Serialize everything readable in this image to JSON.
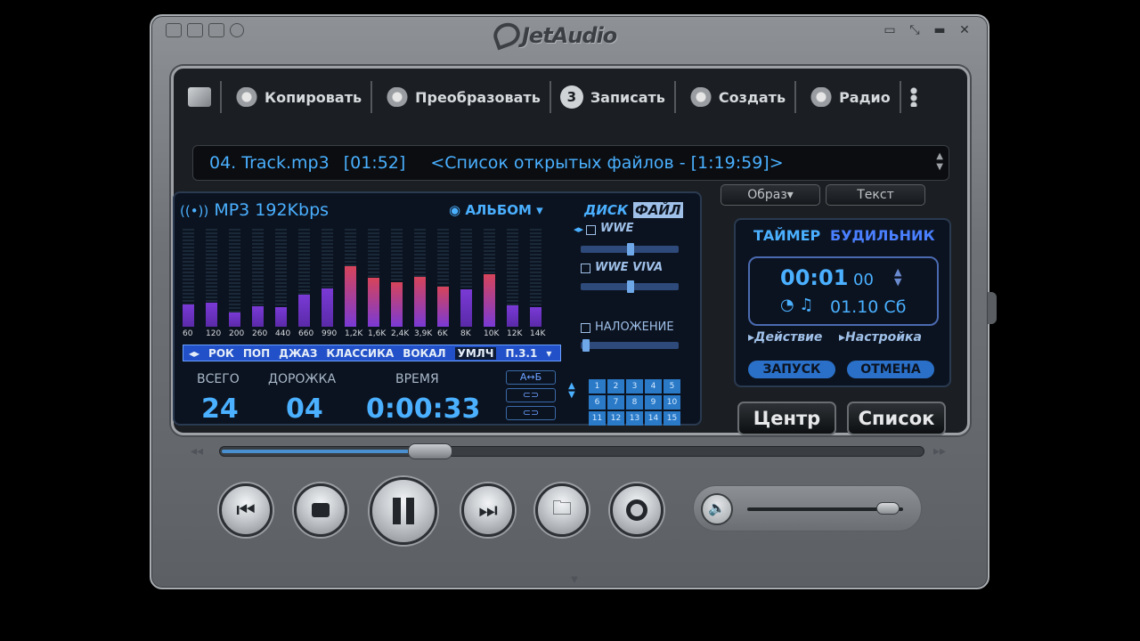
{
  "app": {
    "name": "JetAudio"
  },
  "titlebar": {
    "left_icons": [
      "menu-icon",
      "mini-icon",
      "skin-icon",
      "info-icon"
    ],
    "right_icons": [
      "minimize-tray-icon",
      "restore-icon",
      "minimize-icon",
      "close-icon"
    ]
  },
  "toolbar": {
    "items": [
      {
        "label": "",
        "icon": "media-center-icon"
      },
      {
        "label": "Копировать",
        "icon": "copy-cd-icon"
      },
      {
        "label": "Преобразовать",
        "icon": "convert-icon"
      },
      {
        "label": "Записать",
        "icon": "burn-icon",
        "glyph": "3"
      },
      {
        "label": "Создать",
        "icon": "create-icon"
      },
      {
        "label": "Радио",
        "icon": "radio-icon"
      },
      {
        "label": "",
        "icon": "more-icon"
      }
    ]
  },
  "tracklist": {
    "track": "04. Track.mp3",
    "duration": "[01:52]",
    "playlist": "<Список открытых файлов - [1:19:59]>"
  },
  "view_buttons": {
    "image": "Образ▾",
    "text": "Текст"
  },
  "display": {
    "format": "MP3 192Kbps",
    "album_label": "АЛЬБОМ",
    "mode_disk": "ДИСК",
    "mode_file": "ФАЙЛ",
    "eq_frequencies": [
      "60",
      "120",
      "200",
      "260",
      "440",
      "660",
      "990",
      "1,2K",
      "1,6K",
      "2,4K",
      "3,9K",
      "6K",
      "8K",
      "10K",
      "12K",
      "14K"
    ],
    "eq_levels": [
      0.35,
      0.37,
      0.22,
      0.32,
      0.31,
      0.5,
      0.6,
      0.95,
      0.77,
      0.7,
      0.78,
      0.62,
      0.58,
      0.82,
      0.33,
      0.3
    ],
    "presets": [
      "РОК",
      "ПОП",
      "ДЖАЗ",
      "КЛАССИКА",
      "ВОКАЛ"
    ],
    "preset_selected": "УМЛЧ",
    "preset_slot": "П.3.1",
    "wide_label": "WWE",
    "viva_label": "WWE VIVA",
    "overlay_label": "НАЛОЖЕНИЕ",
    "total_label": "ВСЕГО",
    "total_value": "24",
    "track_label": "ДОРОЖКА",
    "track_value": "04",
    "time_label": "ВРЕМЯ",
    "time_value": "0:00:33",
    "ab_label": "A↔Б",
    "repeat_label": "⊂⊃",
    "shuffle_label": "⊂⊃",
    "number_buttons": [
      "1",
      "2",
      "3",
      "4",
      "5",
      "6",
      "7",
      "8",
      "9",
      "10",
      "11",
      "12",
      "13",
      "14",
      "15"
    ]
  },
  "timer": {
    "tab_timer": "ТАЙМЕР",
    "tab_alarm": "БУДИЛЬНИК",
    "time": "00:01",
    "seconds": "00",
    "date": "01.10 Сб",
    "action_label": "Действие",
    "settings_label": "Настройка",
    "start_label": "ЗАПУСК",
    "cancel_label": "ОТМЕНА"
  },
  "side_buttons": {
    "center": "Центр",
    "list": "Список"
  },
  "playback": {
    "position_fraction": 0.3,
    "volume_fraction": 0.9
  },
  "colors": {
    "accent": "#4ab0ff",
    "eq_high": "#d6445a",
    "eq_low": "#7a3ad6"
  }
}
